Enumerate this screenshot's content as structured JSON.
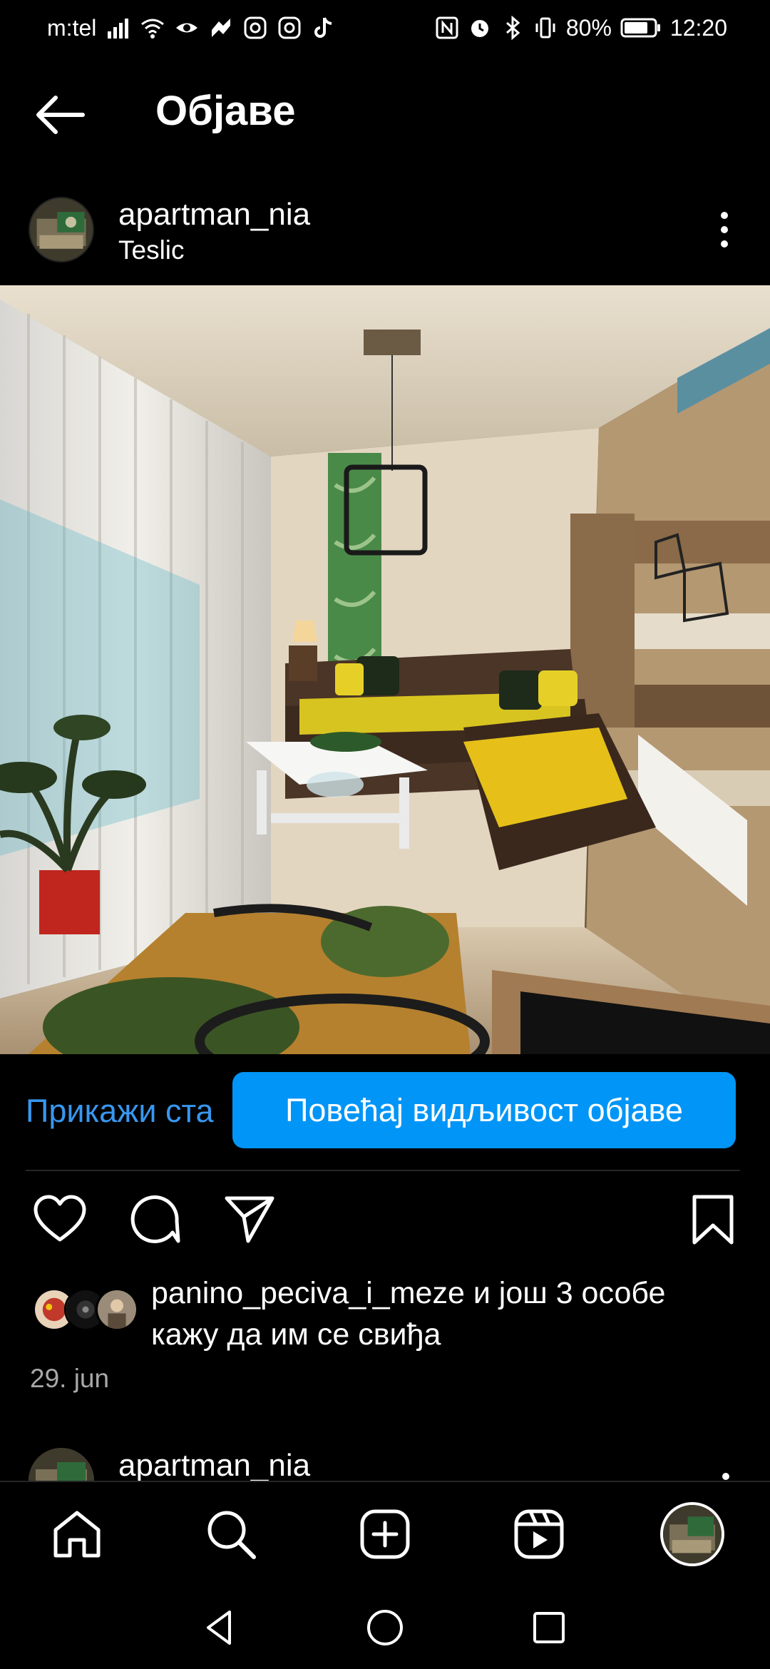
{
  "status_bar": {
    "carrier": "m:tel",
    "battery": "80%",
    "time": "12:20"
  },
  "header": {
    "title": "Објаве"
  },
  "post": {
    "username": "apartman_nia",
    "location": "Teslic",
    "insights_label": "Прикажи ста",
    "promote_label": "Повећај видљивост објаве",
    "likes_user": "panino_peciva_i_meze",
    "likes_rest_1": " и још 3 особе",
    "likes_rest_2": "кажу да им се свиђа",
    "date": "29. jun"
  },
  "next_post": {
    "username": "apartman_nia"
  },
  "icons": {
    "back": "arrow-left-icon",
    "more": "more-vertical-icon",
    "like": "heart-icon",
    "comment": "comment-icon",
    "share": "send-icon",
    "save": "bookmark-icon",
    "home": "home-icon",
    "search": "search-icon",
    "create": "plus-square-icon",
    "reels": "reels-icon"
  },
  "colors": {
    "accent": "#0095f6",
    "link": "#3897f0",
    "background": "#000000"
  }
}
